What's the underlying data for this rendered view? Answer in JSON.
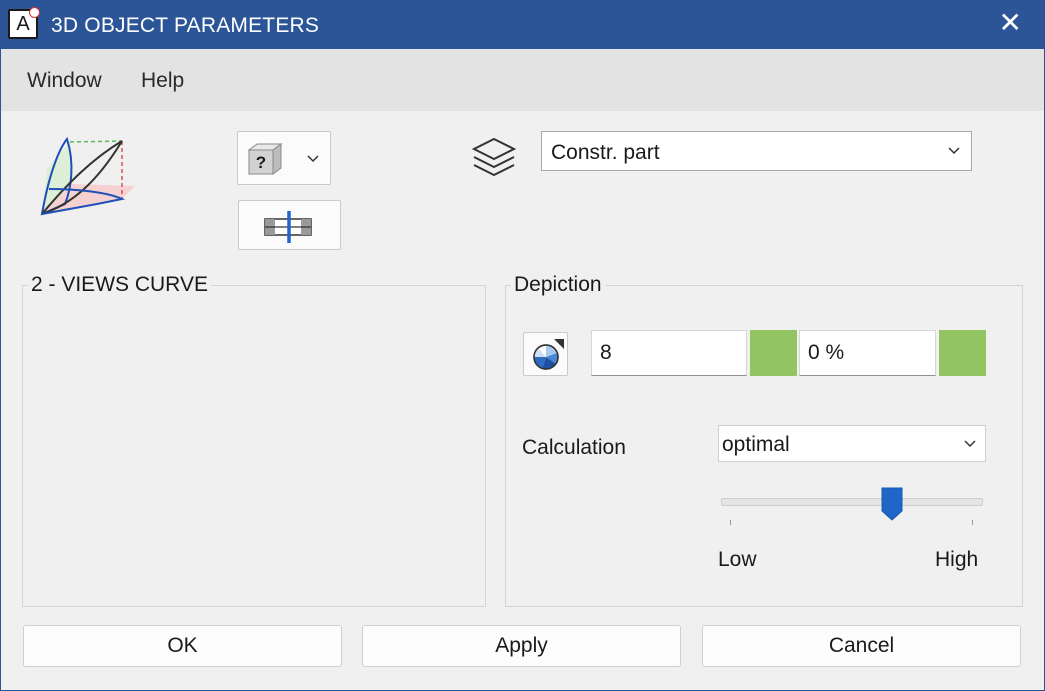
{
  "window": {
    "title": "3D OBJECT PARAMETERS",
    "app_icon_letter": "A",
    "close_glyph": "✕"
  },
  "menu": {
    "items": [
      {
        "label": "Window"
      },
      {
        "label": "Help"
      }
    ]
  },
  "toolbar": {
    "view_type_glyph": "?",
    "layer_select_value": "Constr. part"
  },
  "views_group": {
    "title": "2 - VIEWS CURVE"
  },
  "depiction": {
    "title": "Depiction",
    "value_field": "8",
    "percent_field": "0 %",
    "swatch_color": "#92c562",
    "calculation_label": "Calculation",
    "calculation_value": "optimal",
    "slider_low_label": "Low",
    "slider_high_label": "High",
    "slider_level": 0.65
  },
  "buttons": {
    "ok": "OK",
    "apply": "Apply",
    "cancel": "Cancel"
  },
  "colors": {
    "titlebar": "#2b5597",
    "accent": "#1f66c8"
  }
}
